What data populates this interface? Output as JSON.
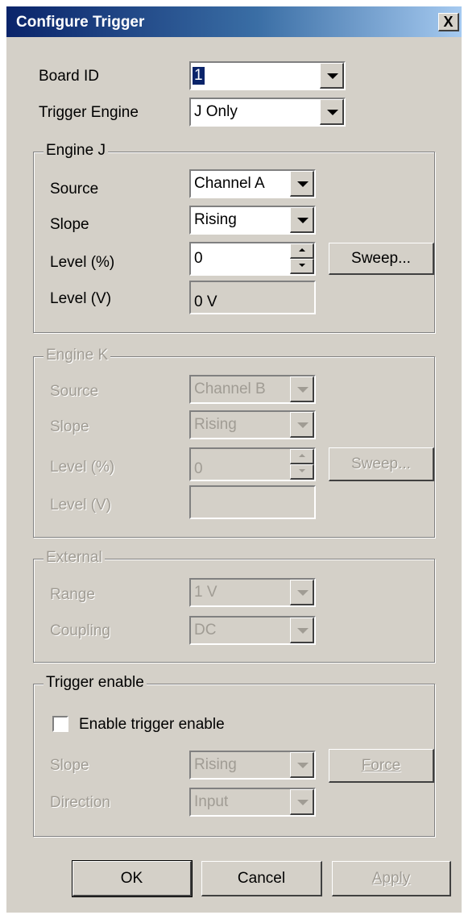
{
  "window": {
    "title": "Configure Trigger",
    "close_glyph": "X"
  },
  "board_id": {
    "label": "Board ID",
    "value": "1"
  },
  "trigger_engine": {
    "label": "Trigger Engine",
    "value": "J Only"
  },
  "engine_j": {
    "title": "Engine J",
    "source_label": "Source",
    "source_value": "Channel A",
    "slope_label": "Slope",
    "slope_value": "Rising",
    "level_pct_label": "Level (%)",
    "level_pct_value": "0",
    "level_v_label": "Level (V)",
    "level_v_value": "0 V",
    "sweep_label": "Sweep..."
  },
  "engine_k": {
    "title": "Engine K",
    "source_label": "Source",
    "source_value": "Channel B",
    "slope_label": "Slope",
    "slope_value": "Rising",
    "level_pct_label": "Level (%)",
    "level_pct_value": "0",
    "level_v_label": "Level (V)",
    "level_v_value": "",
    "sweep_label": "Sweep..."
  },
  "external": {
    "title": "External",
    "range_label": "Range",
    "range_value": "1 V",
    "coupling_label": "Coupling",
    "coupling_value": "DC"
  },
  "trigger_enable": {
    "title": "Trigger enable",
    "checkbox_label": "Enable trigger enable",
    "checked": false,
    "slope_label": "Slope",
    "slope_value": "Rising",
    "direction_label": "Direction",
    "direction_value": "Input",
    "force_label": "Force"
  },
  "buttons": {
    "ok": "OK",
    "cancel": "Cancel",
    "apply": "Apply"
  },
  "colors": {
    "face": "#d4d0c8",
    "title_start": "#0a246a",
    "title_end": "#a6caf0",
    "disabled_text": "#a09c94"
  }
}
